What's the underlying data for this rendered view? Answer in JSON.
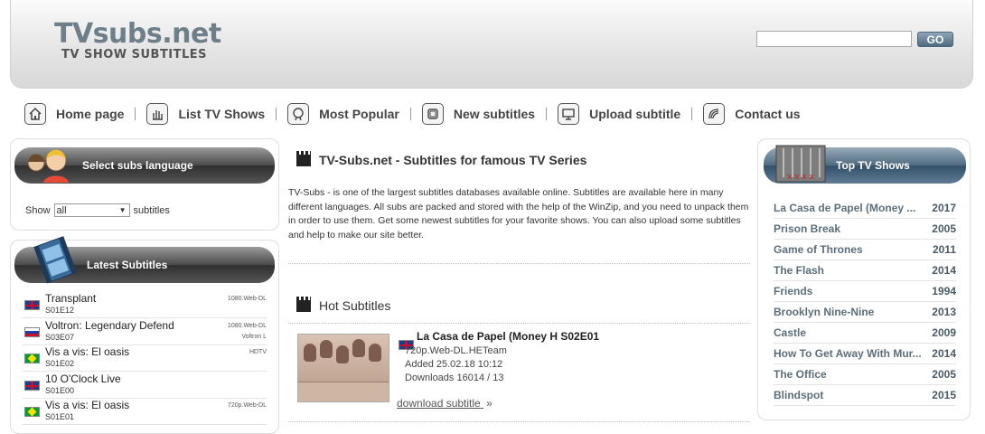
{
  "header": {
    "logo_main": "TVsubs.net",
    "logo_sub": "TV SHOW SUBTITLES",
    "search_value": "",
    "go_label": "GO"
  },
  "nav": [
    {
      "label": "Home page",
      "icon": "home-icon"
    },
    {
      "label": "List TV Shows",
      "icon": "hand-icon"
    },
    {
      "label": "Most Popular",
      "icon": "popular-icon"
    },
    {
      "label": "New subtitles",
      "icon": "document-icon"
    },
    {
      "label": "Upload subtitle",
      "icon": "monitor-icon"
    },
    {
      "label": "Contact us",
      "icon": "contact-icon"
    }
  ],
  "language": {
    "title": "Select subs language",
    "show_label": "Show",
    "selected": "all",
    "suffix": "subtitles"
  },
  "latest": {
    "title": "Latest Subtitles",
    "items": [
      {
        "title": "Transplant",
        "episode": "S01E12",
        "quality": "1080.Web-DL",
        "team": "",
        "flag": "uk"
      },
      {
        "title": "Voltron: Legendary Defend",
        "episode": "S03E07",
        "quality": "1080.Web-DL",
        "team": "Voltron L",
        "flag": "ru"
      },
      {
        "title": "Vis a vis: El oasis",
        "episode": "S01E02",
        "quality": "HDTV",
        "team": "",
        "flag": "br"
      },
      {
        "title": "10 O'Clock Live",
        "episode": "S01E00",
        "quality": "",
        "team": "",
        "flag": "uk"
      },
      {
        "title": "Vis a vis: El oasis",
        "episode": "S01E01",
        "quality": "720p.Web-DL",
        "team": "",
        "flag": "br"
      }
    ]
  },
  "main": {
    "title": "TV-Subs.net - Subtitles for famous TV Series",
    "intro": "TV-Subs - is one of the largest subtitles databases available online. Subtitles are available here in many different languages. All subs are packed and stored with the help of the WinZip, and you need to unpack them in order to use them. Get some newest subtitles for your favorite shows. You can also upload some subtitles and help to make our site better.",
    "hot_title": "Hot Subtitles",
    "hot": {
      "name": "La Casa de Papel (Money H S02E01",
      "release": "720p.Web-DL.HETeam",
      "added": "Added 25.02.18 10:12",
      "downloads": "Downloads 16014 / 13",
      "download_label": "download subtitle",
      "download_arrow": "»"
    }
  },
  "top_shows": {
    "title": "Top TV Shows",
    "items": [
      {
        "name": "La Casa de Papel (Money ...",
        "year": "2017"
      },
      {
        "name": "Prison Break",
        "year": "2005"
      },
      {
        "name": "Game of Thrones",
        "year": "2011"
      },
      {
        "name": "The Flash",
        "year": "2014"
      },
      {
        "name": "Friends",
        "year": "1994"
      },
      {
        "name": "Brooklyn Nine-Nine",
        "year": "2013"
      },
      {
        "name": "Castle",
        "year": "2009"
      },
      {
        "name": "How To Get Away With Mur...",
        "year": "2014"
      },
      {
        "name": "The Office",
        "year": "2005"
      },
      {
        "name": "Blindspot",
        "year": "2015"
      }
    ]
  },
  "colors": {
    "accent": "#4f6a80",
    "pill_dark": "#2f2f2f",
    "top_show_text": "#5c6e7c"
  }
}
